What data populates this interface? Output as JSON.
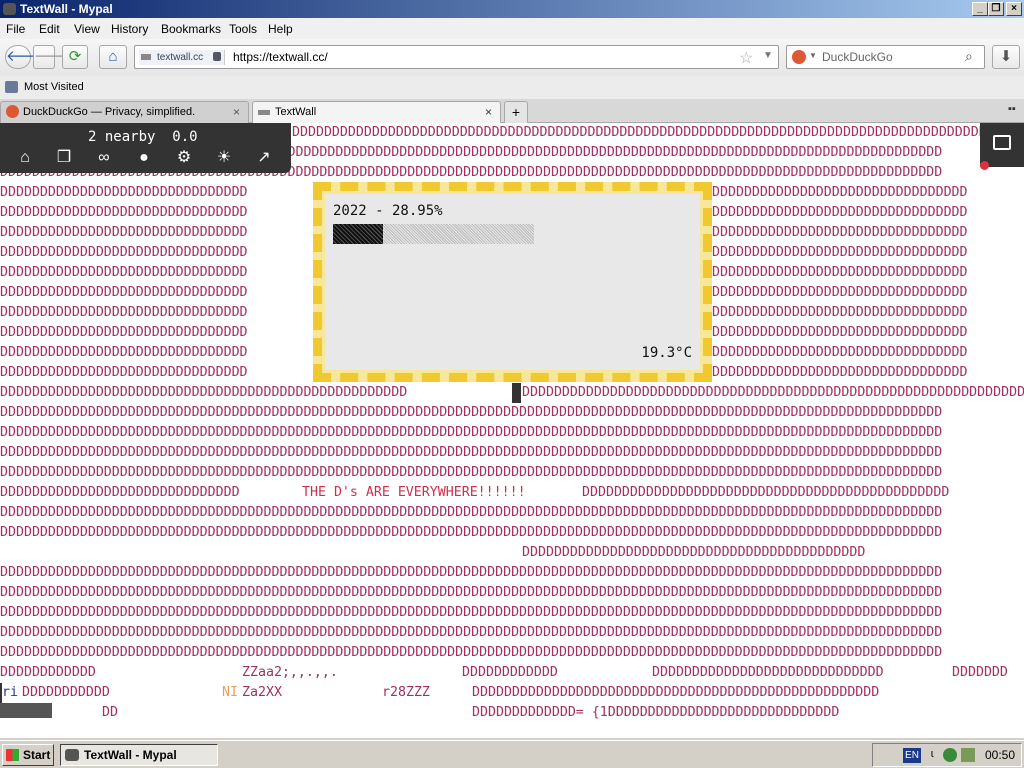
{
  "window": {
    "title": "TextWall - Mypal"
  },
  "menu": [
    "File",
    "Edit",
    "View",
    "History",
    "Bookmarks",
    "Tools",
    "Help"
  ],
  "nav": {
    "site_badge": "textwall.cc",
    "url": "https://textwall.cc/",
    "search_placeholder": "DuckDuckGo"
  },
  "bookmarks": {
    "most_visited": "Most Visited"
  },
  "tabs": [
    {
      "label": "DuckDuckGo — Privacy, simplified."
    },
    {
      "label": "TextWall"
    }
  ],
  "overlay": {
    "status": "2 nearby  0.0",
    "icons": [
      "home-icon",
      "copy-icon",
      "link-icon",
      "palette-icon",
      "settings-icon",
      "brightness-icon",
      "expand-icon"
    ]
  },
  "popup": {
    "headline": "2022 - 28.95%",
    "progress": 0.2895,
    "temperature": "19.3°C"
  },
  "wall": {
    "row0": "DDDDDDDDDDDDDDDDDDDDDDDDDDDDDDDDDDDDDDDDDDDDDDDDDDDDDDDDDDDDDDDDDDDDDDDDDDDDDDDDDDDDDDDDDDDDDDDDDDDDDDDDDDDDDDDD",
    "fill": "DDDDDDDDDDDDDDDDDDDDDDDDDDDDDDDDDDDDDDDDDDDDDDDDDDDDDDDDDDDDDDDDDDDDDDDDDDDDDDDDDDDDDDDDDDDDDDDDDDDDDDDDDDDDDDDDDDDDDD",
    "left31": "DDDDDDDDDDDDDDDDDDDDDDDDDDDDDDD",
    "right31": "DDDDDDDDDDDDDDDDDDDDDDDDDDDDDDDD",
    "cursor_row_left": "DDDDDDDDDDDDDDDDDDDDDDDDDDDDDDDDDDDDDDDDDDDDDDDDDDD",
    "cursor_row_right": "DDDDDDDDDDDDDDDDDDDDDDDDDDDDDDDDDDDDDDDDDDDDDDDDDDDDDDDDDDDDDDDDDDDDDD",
    "d_left": "DDDDDDDDDDDDDDDDDDDDDDDDDDDDDD",
    "message": "THE D's ARE EVERYWHERE!!!!!!",
    "d_right": "DDDDDDDDDDDDDDDDDDDDDDDDDDDDDDDDDDDDDDDDDDDDDD",
    "partial_row": "DDDDDDDDDDDDDDDDDDDDDDDDDDDDDDDDDDDDDDDDDDD",
    "r27a": "DDDDDDDDDDDD",
    "r27b": "ZZaa2;,,.,,.",
    "r27c": "DDDDDDDDDDDD",
    "r27d": "DDDDDDDDDDDDDDDDDDDDDDDDDDDDD",
    "r27e": "DDDDDDD",
    "r28a": "ri",
    "r28b": "DDDDDDDDDDD",
    "r28c": "NI",
    "r28d": "Za2XX",
    "r28e": "r28ZZZ",
    "r28f": "DDDDDDDDDDDDDDDDDDDDDDDDDDDDDDDDDDDDDDDDDDDDDDDDDDD",
    "r29a": "DD",
    "r29b": "DDDDDDDDDDDDD= {1DDDDDDDDDDDDDDDDDDDDDDDDDDDDD"
  },
  "taskbar": {
    "start": "Start",
    "task": "TextWall - Mypal",
    "lang": "EN",
    "clock": "00:50"
  },
  "colors": {
    "wall_text": "#a03060",
    "popup_border": "#f0c830",
    "overlay_bg": "#333333",
    "accent_orange": "#e8a060"
  }
}
